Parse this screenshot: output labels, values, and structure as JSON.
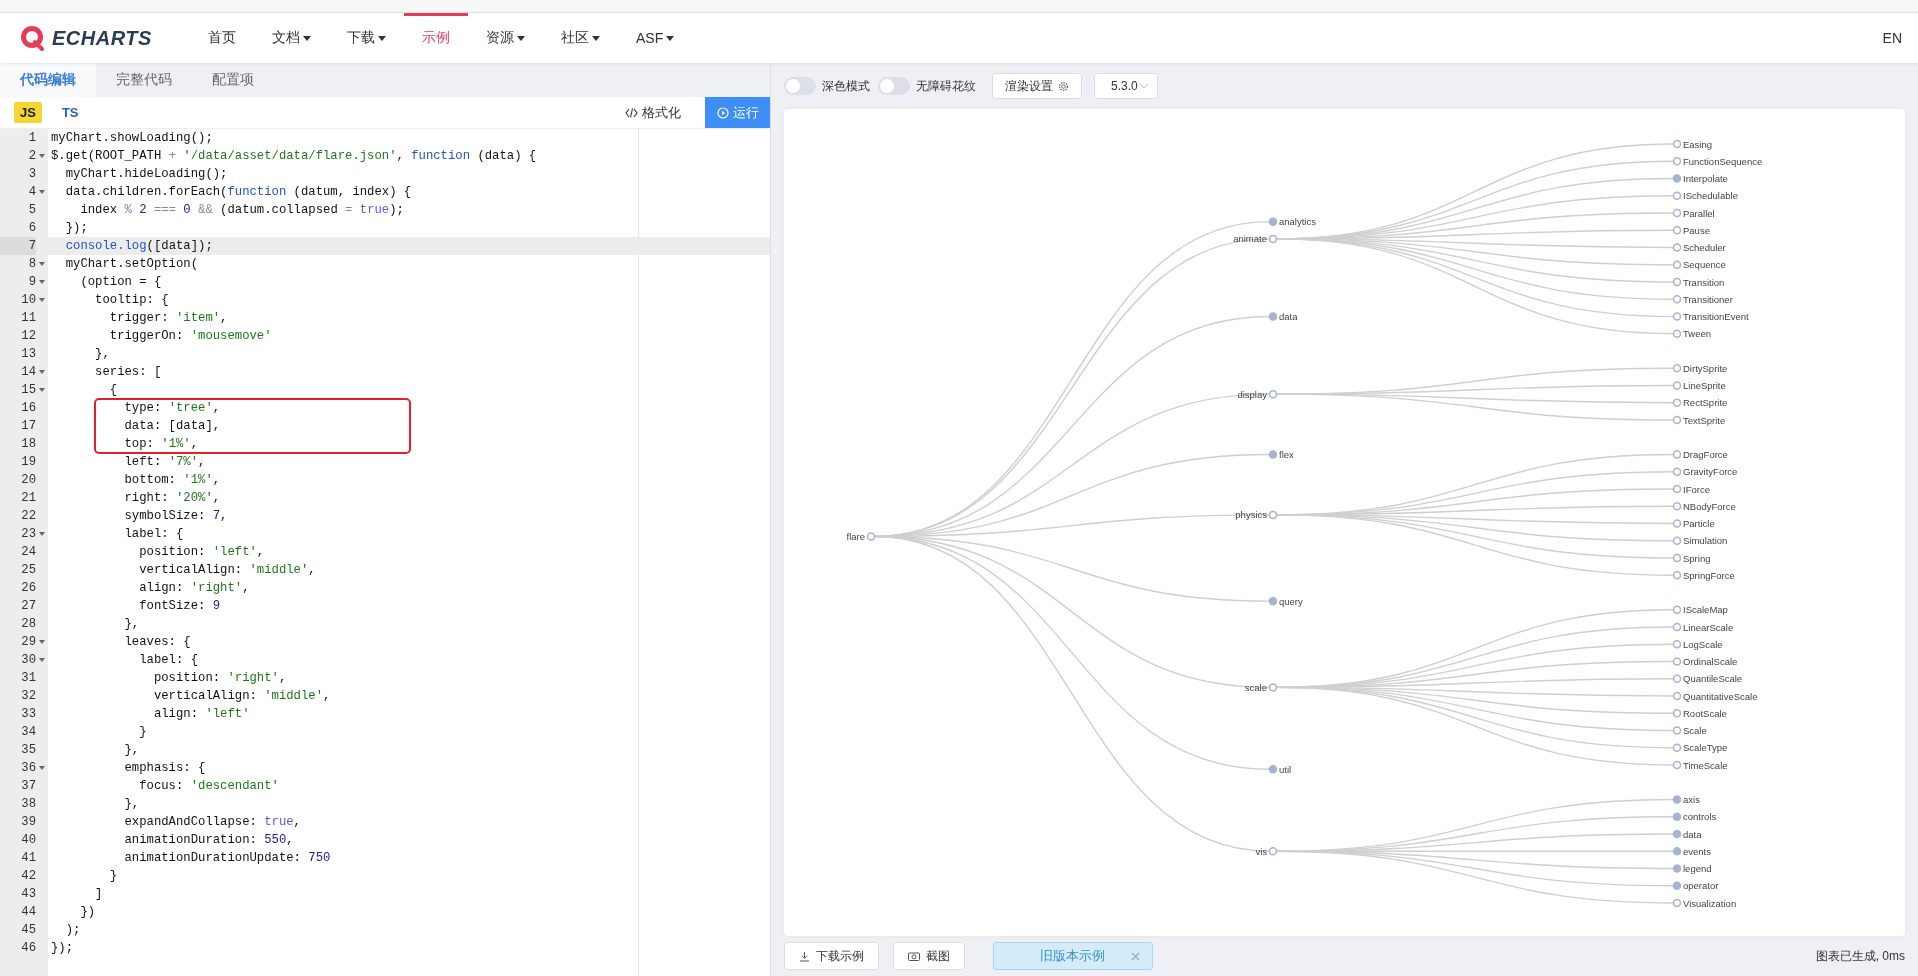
{
  "nav": {
    "logo": "ECHARTS",
    "items": [
      {
        "label": "首页",
        "dropdown": false,
        "selected": false
      },
      {
        "label": "文档",
        "dropdown": true,
        "selected": false
      },
      {
        "label": "下载",
        "dropdown": true,
        "selected": false
      },
      {
        "label": "示例",
        "dropdown": false,
        "selected": true
      },
      {
        "label": "资源",
        "dropdown": true,
        "selected": false
      },
      {
        "label": "社区",
        "dropdown": true,
        "selected": false
      },
      {
        "label": "ASF",
        "dropdown": true,
        "selected": false
      }
    ],
    "language": "EN"
  },
  "editor": {
    "tabs": [
      {
        "label": "代码编辑",
        "selected": true
      },
      {
        "label": "完整代码",
        "selected": false
      },
      {
        "label": "配置项",
        "selected": false
      }
    ],
    "languages": [
      {
        "label": "JS",
        "selected": true
      },
      {
        "label": "TS",
        "selected": false
      }
    ],
    "format_button": "格式化",
    "run_button": "运行",
    "lines": [
      {
        "number": "1",
        "foldable": false,
        "current": false,
        "boxed": false,
        "tokens": [
          {
            "kind": "plain",
            "text": "myChart.showLoading();"
          }
        ]
      },
      {
        "number": "2",
        "foldable": true,
        "current": false,
        "boxed": false,
        "tokens": [
          {
            "kind": "plain",
            "text": "$.get(ROOT_PATH "
          },
          {
            "kind": "op",
            "text": "+ "
          },
          {
            "kind": "string",
            "text": "'/data/asset/data/flare.json'"
          },
          {
            "kind": "plain",
            "text": ", "
          },
          {
            "kind": "keyword",
            "text": "function"
          },
          {
            "kind": "plain",
            "text": " (data) {"
          }
        ]
      },
      {
        "number": "3",
        "foldable": false,
        "current": false,
        "boxed": false,
        "tokens": [
          {
            "kind": "plain",
            "text": "  myChart.hideLoading();"
          }
        ]
      },
      {
        "number": "4",
        "foldable": true,
        "current": false,
        "boxed": false,
        "tokens": [
          {
            "kind": "plain",
            "text": "  data.children.forEach("
          },
          {
            "kind": "keyword",
            "text": "function"
          },
          {
            "kind": "plain",
            "text": " (datum, index) {"
          }
        ]
      },
      {
        "number": "5",
        "foldable": false,
        "current": false,
        "boxed": false,
        "tokens": [
          {
            "kind": "plain",
            "text": "    index "
          },
          {
            "kind": "op",
            "text": "% "
          },
          {
            "kind": "number",
            "text": "2"
          },
          {
            "kind": "op",
            "text": " === "
          },
          {
            "kind": "number",
            "text": "0"
          },
          {
            "kind": "op",
            "text": " && "
          },
          {
            "kind": "plain",
            "text": "(datum.collapsed "
          },
          {
            "kind": "op",
            "text": "= "
          },
          {
            "kind": "bool",
            "text": "true"
          },
          {
            "kind": "plain",
            "text": ");"
          }
        ]
      },
      {
        "number": "6",
        "foldable": false,
        "current": false,
        "boxed": false,
        "tokens": [
          {
            "kind": "plain",
            "text": "  });"
          }
        ]
      },
      {
        "number": "7",
        "foldable": false,
        "current": true,
        "boxed": false,
        "tokens": [
          {
            "kind": "keyword",
            "text": "  console.log"
          },
          {
            "kind": "plain",
            "text": "([data]);"
          }
        ]
      },
      {
        "number": "8",
        "foldable": true,
        "current": false,
        "boxed": false,
        "tokens": [
          {
            "kind": "plain",
            "text": "  myChart.setOption("
          }
        ]
      },
      {
        "number": "9",
        "foldable": true,
        "current": false,
        "boxed": false,
        "tokens": [
          {
            "kind": "plain",
            "text": "    (option = {"
          }
        ]
      },
      {
        "number": "10",
        "foldable": true,
        "current": false,
        "boxed": false,
        "tokens": [
          {
            "kind": "plain",
            "text": "      tooltip: {"
          }
        ]
      },
      {
        "number": "11",
        "foldable": false,
        "current": false,
        "boxed": false,
        "tokens": [
          {
            "kind": "plain",
            "text": "        trigger: "
          },
          {
            "kind": "string",
            "text": "'item'"
          },
          {
            "kind": "plain",
            "text": ","
          }
        ]
      },
      {
        "number": "12",
        "foldable": false,
        "current": false,
        "boxed": false,
        "tokens": [
          {
            "kind": "plain",
            "text": "        triggerOn: "
          },
          {
            "kind": "string",
            "text": "'mousemove'"
          }
        ]
      },
      {
        "number": "13",
        "foldable": false,
        "current": false,
        "boxed": false,
        "tokens": [
          {
            "kind": "plain",
            "text": "      },"
          }
        ]
      },
      {
        "number": "14",
        "foldable": true,
        "current": false,
        "boxed": false,
        "tokens": [
          {
            "kind": "plain",
            "text": "      series: ["
          }
        ]
      },
      {
        "number": "15",
        "foldable": true,
        "current": false,
        "boxed": false,
        "tokens": [
          {
            "kind": "plain",
            "text": "        {"
          }
        ]
      },
      {
        "number": "16",
        "foldable": false,
        "current": false,
        "boxed": true,
        "tokens": [
          {
            "kind": "plain",
            "text": "          type: "
          },
          {
            "kind": "string",
            "text": "'tree'"
          },
          {
            "kind": "plain",
            "text": ","
          }
        ]
      },
      {
        "number": "17",
        "foldable": false,
        "current": false,
        "boxed": true,
        "tokens": [
          {
            "kind": "plain",
            "text": "          data: [data],"
          }
        ]
      },
      {
        "number": "18",
        "foldable": false,
        "current": false,
        "boxed": true,
        "tokens": [
          {
            "kind": "plain",
            "text": "          top: "
          },
          {
            "kind": "string",
            "text": "'1%'"
          },
          {
            "kind": "plain",
            "text": ","
          }
        ]
      },
      {
        "number": "19",
        "foldable": false,
        "current": false,
        "boxed": false,
        "tokens": [
          {
            "kind": "plain",
            "text": "          left: "
          },
          {
            "kind": "string",
            "text": "'7%'"
          },
          {
            "kind": "plain",
            "text": ","
          }
        ]
      },
      {
        "number": "20",
        "foldable": false,
        "current": false,
        "boxed": false,
        "tokens": [
          {
            "kind": "plain",
            "text": "          bottom: "
          },
          {
            "kind": "string",
            "text": "'1%'"
          },
          {
            "kind": "plain",
            "text": ","
          }
        ]
      },
      {
        "number": "21",
        "foldable": false,
        "current": false,
        "boxed": false,
        "tokens": [
          {
            "kind": "plain",
            "text": "          right: "
          },
          {
            "kind": "string",
            "text": "'20%'"
          },
          {
            "kind": "plain",
            "text": ","
          }
        ]
      },
      {
        "number": "22",
        "foldable": false,
        "current": false,
        "boxed": false,
        "tokens": [
          {
            "kind": "plain",
            "text": "          symbolSize: "
          },
          {
            "kind": "number",
            "text": "7"
          },
          {
            "kind": "plain",
            "text": ","
          }
        ]
      },
      {
        "number": "23",
        "foldable": true,
        "current": false,
        "boxed": false,
        "tokens": [
          {
            "kind": "plain",
            "text": "          label: {"
          }
        ]
      },
      {
        "number": "24",
        "foldable": false,
        "current": false,
        "boxed": false,
        "tokens": [
          {
            "kind": "plain",
            "text": "            position: "
          },
          {
            "kind": "string",
            "text": "'left'"
          },
          {
            "kind": "plain",
            "text": ","
          }
        ]
      },
      {
        "number": "25",
        "foldable": false,
        "current": false,
        "boxed": false,
        "tokens": [
          {
            "kind": "plain",
            "text": "            verticalAlign: "
          },
          {
            "kind": "string",
            "text": "'middle'"
          },
          {
            "kind": "plain",
            "text": ","
          }
        ]
      },
      {
        "number": "26",
        "foldable": false,
        "current": false,
        "boxed": false,
        "tokens": [
          {
            "kind": "plain",
            "text": "            align: "
          },
          {
            "kind": "string",
            "text": "'right'"
          },
          {
            "kind": "plain",
            "text": ","
          }
        ]
      },
      {
        "number": "27",
        "foldable": false,
        "current": false,
        "boxed": false,
        "tokens": [
          {
            "kind": "plain",
            "text": "            fontSize: "
          },
          {
            "kind": "number",
            "text": "9"
          }
        ]
      },
      {
        "number": "28",
        "foldable": false,
        "current": false,
        "boxed": false,
        "tokens": [
          {
            "kind": "plain",
            "text": "          },"
          }
        ]
      },
      {
        "number": "29",
        "foldable": true,
        "current": false,
        "boxed": false,
        "tokens": [
          {
            "kind": "plain",
            "text": "          leaves: {"
          }
        ]
      },
      {
        "number": "30",
        "foldable": true,
        "current": false,
        "boxed": false,
        "tokens": [
          {
            "kind": "plain",
            "text": "            label: {"
          }
        ]
      },
      {
        "number": "31",
        "foldable": false,
        "current": false,
        "boxed": false,
        "tokens": [
          {
            "kind": "plain",
            "text": "              position: "
          },
          {
            "kind": "string",
            "text": "'right'"
          },
          {
            "kind": "plain",
            "text": ","
          }
        ]
      },
      {
        "number": "32",
        "foldable": false,
        "current": false,
        "boxed": false,
        "tokens": [
          {
            "kind": "plain",
            "text": "              verticalAlign: "
          },
          {
            "kind": "string",
            "text": "'middle'"
          },
          {
            "kind": "plain",
            "text": ","
          }
        ]
      },
      {
        "number": "33",
        "foldable": false,
        "current": false,
        "boxed": false,
        "tokens": [
          {
            "kind": "plain",
            "text": "              align: "
          },
          {
            "kind": "string",
            "text": "'left'"
          }
        ]
      },
      {
        "number": "34",
        "foldable": false,
        "current": false,
        "boxed": false,
        "tokens": [
          {
            "kind": "plain",
            "text": "            }"
          }
        ]
      },
      {
        "number": "35",
        "foldable": false,
        "current": false,
        "boxed": false,
        "tokens": [
          {
            "kind": "plain",
            "text": "          },"
          }
        ]
      },
      {
        "number": "36",
        "foldable": true,
        "current": false,
        "boxed": false,
        "tokens": [
          {
            "kind": "plain",
            "text": "          emphasis: {"
          }
        ]
      },
      {
        "number": "37",
        "foldable": false,
        "current": false,
        "boxed": false,
        "tokens": [
          {
            "kind": "plain",
            "text": "            focus: "
          },
          {
            "kind": "string",
            "text": "'descendant'"
          }
        ]
      },
      {
        "number": "38",
        "foldable": false,
        "current": false,
        "boxed": false,
        "tokens": [
          {
            "kind": "plain",
            "text": "          },"
          }
        ]
      },
      {
        "number": "39",
        "foldable": false,
        "current": false,
        "boxed": false,
        "tokens": [
          {
            "kind": "plain",
            "text": "          expandAndCollapse: "
          },
          {
            "kind": "bool",
            "text": "true"
          },
          {
            "kind": "plain",
            "text": ","
          }
        ]
      },
      {
        "number": "40",
        "foldable": false,
        "current": false,
        "boxed": false,
        "tokens": [
          {
            "kind": "plain",
            "text": "          animationDuration: "
          },
          {
            "kind": "number",
            "text": "550"
          },
          {
            "kind": "plain",
            "text": ","
          }
        ]
      },
      {
        "number": "41",
        "foldable": false,
        "current": false,
        "boxed": false,
        "tokens": [
          {
            "kind": "plain",
            "text": "          animationDurationUpdate: "
          },
          {
            "kind": "number",
            "text": "750"
          }
        ]
      },
      {
        "number": "42",
        "foldable": false,
        "current": false,
        "boxed": false,
        "tokens": [
          {
            "kind": "plain",
            "text": "        }"
          }
        ]
      },
      {
        "number": "43",
        "foldable": false,
        "current": false,
        "boxed": false,
        "tokens": [
          {
            "kind": "plain",
            "text": "      ]"
          }
        ]
      },
      {
        "number": "44",
        "foldable": false,
        "current": false,
        "boxed": false,
        "tokens": [
          {
            "kind": "plain",
            "text": "    })"
          }
        ]
      },
      {
        "number": "45",
        "foldable": false,
        "current": false,
        "boxed": false,
        "tokens": [
          {
            "kind": "plain",
            "text": "  );"
          }
        ]
      },
      {
        "number": "46",
        "foldable": false,
        "current": false,
        "boxed": false,
        "tokens": [
          {
            "kind": "plain",
            "text": "});"
          }
        ]
      }
    ]
  },
  "preview": {
    "toggles": [
      {
        "label": "深色模式",
        "on": false
      },
      {
        "label": "无障碍花纹",
        "on": false
      }
    ],
    "render_settings": "渲染设置",
    "version": "5.3.0",
    "chart": {
      "tree": {
        "name": "flare",
        "collapsed": false,
        "children": [
          {
            "name": "analytics",
            "collapsed": true
          },
          {
            "name": "animate",
            "collapsed": false,
            "children": [
              {
                "name": "Easing",
                "collapsed": false
              },
              {
                "name": "FunctionSequence",
                "collapsed": false
              },
              {
                "name": "Interpolate",
                "collapsed": true
              },
              {
                "name": "ISchedulable",
                "collapsed": false
              },
              {
                "name": "Parallel",
                "collapsed": false
              },
              {
                "name": "Pause",
                "collapsed": false
              },
              {
                "name": "Scheduler",
                "collapsed": false
              },
              {
                "name": "Sequence",
                "collapsed": false
              },
              {
                "name": "Transition",
                "collapsed": false
              },
              {
                "name": "Transitioner",
                "collapsed": false
              },
              {
                "name": "TransitionEvent",
                "collapsed": false
              },
              {
                "name": "Tween",
                "collapsed": false
              }
            ]
          },
          {
            "name": "data",
            "collapsed": true
          },
          {
            "name": "display",
            "collapsed": false,
            "children": [
              {
                "name": "DirtySprite",
                "collapsed": false
              },
              {
                "name": "LineSprite",
                "collapsed": false
              },
              {
                "name": "RectSprite",
                "collapsed": false
              },
              {
                "name": "TextSprite",
                "collapsed": false
              }
            ]
          },
          {
            "name": "flex",
            "collapsed": true
          },
          {
            "name": "physics",
            "collapsed": false,
            "children": [
              {
                "name": "DragForce",
                "collapsed": false
              },
              {
                "name": "GravityForce",
                "collapsed": false
              },
              {
                "name": "IForce",
                "collapsed": false
              },
              {
                "name": "NBodyForce",
                "collapsed": false
              },
              {
                "name": "Particle",
                "collapsed": false
              },
              {
                "name": "Simulation",
                "collapsed": false
              },
              {
                "name": "Spring",
                "collapsed": false
              },
              {
                "name": "SpringForce",
                "collapsed": false
              }
            ]
          },
          {
            "name": "query",
            "collapsed": true
          },
          {
            "name": "scale",
            "collapsed": false,
            "children": [
              {
                "name": "IScaleMap",
                "collapsed": false
              },
              {
                "name": "LinearScale",
                "collapsed": false
              },
              {
                "name": "LogScale",
                "collapsed": false
              },
              {
                "name": "OrdinalScale",
                "collapsed": false
              },
              {
                "name": "QuantileScale",
                "collapsed": false
              },
              {
                "name": "QuantitativeScale",
                "collapsed": false
              },
              {
                "name": "RootScale",
                "collapsed": false
              },
              {
                "name": "Scale",
                "collapsed": false
              },
              {
                "name": "ScaleType",
                "collapsed": false
              },
              {
                "name": "TimeScale",
                "collapsed": false
              }
            ]
          },
          {
            "name": "util",
            "collapsed": true
          },
          {
            "name": "vis",
            "collapsed": false,
            "children": [
              {
                "name": "axis",
                "collapsed": true
              },
              {
                "name": "controls",
                "collapsed": true
              },
              {
                "name": "data",
                "collapsed": true
              },
              {
                "name": "events",
                "collapsed": true
              },
              {
                "name": "legend",
                "collapsed": true
              },
              {
                "name": "operator",
                "collapsed": true
              },
              {
                "name": "Visualization",
                "collapsed": false
              }
            ]
          }
        ]
      }
    },
    "toast": "旧版本示例",
    "buttons": [
      {
        "kind": "download",
        "label": "下载示例"
      },
      {
        "kind": "screenshot",
        "label": "截图"
      }
    ],
    "status": "图表已生成, 0ms"
  }
}
